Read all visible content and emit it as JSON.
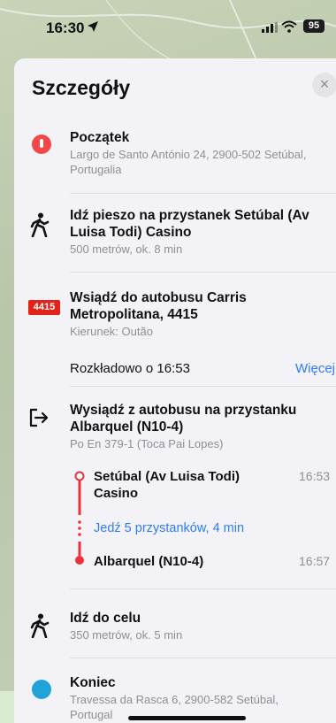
{
  "status_bar": {
    "time": "16:30",
    "battery": "95"
  },
  "sheet": {
    "title": "Szczegóły",
    "close_label": "×"
  },
  "steps": {
    "start": {
      "title": "Początek",
      "subtitle": "Largo de Santo António 24, 2900-502 Setúbal, Portugalia"
    },
    "walk1": {
      "title": "Idź pieszo na przystanek Setúbal (Av Luisa Todi) Casino",
      "subtitle": "500 metrów, ok. 8 min"
    },
    "board": {
      "badge": "4415",
      "title": "Wsiądź do autobusu Carris Metropolitana, 4415",
      "subtitle": "Kierunek: Outão",
      "schedule": "Rozkładowo o 16:53",
      "more": "Więcej"
    },
    "alight": {
      "title": "Wysiądź z autobusu na przystanku Albarquel (N10-4)",
      "subtitle": "Po En 379-1 (Toca Pai Lopes)",
      "from_stop": "Setúbal (Av Luisa Todi) Casino",
      "from_time": "16:53",
      "ride_info": "Jedź 5 przystanków, 4 min",
      "to_stop": "Albarquel (N10-4)",
      "to_time": "16:57"
    },
    "walk2": {
      "title": "Idź do celu",
      "subtitle": "350 metrów, ok. 5 min"
    },
    "end": {
      "title": "Koniec",
      "subtitle": "Travessa da Rasca 6, 2900-582 Setúbal, Portugal"
    }
  },
  "icons": {
    "location_arrow": "location-arrow-icon",
    "signal": "cellular-signal-icon",
    "wifi": "wifi-icon",
    "start": "start-pin-icon",
    "walk": "walking-person-icon",
    "exit": "exit-bus-icon",
    "end": "destination-icon"
  },
  "colors": {
    "accent_link": "#2f7cf6",
    "start_pin": "#f24848",
    "bus_badge": "#e2231a",
    "route_line": "#e8323c",
    "end_pin": "#1fa3d8"
  }
}
